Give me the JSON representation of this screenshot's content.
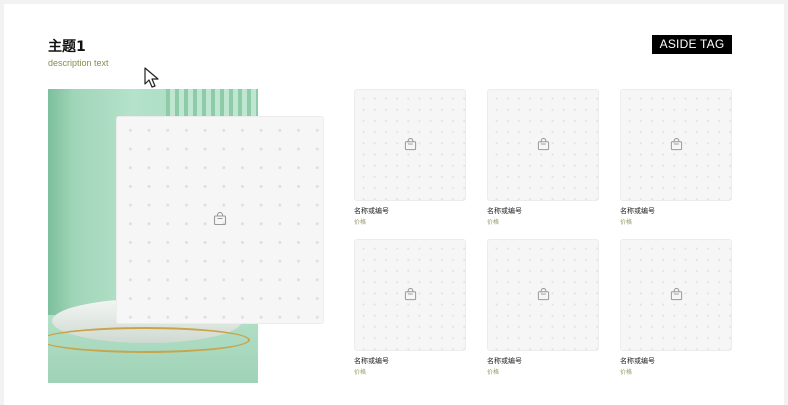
{
  "header": {
    "title": "主题1",
    "description": "description text",
    "aside_tag": "ASIDE TAG"
  },
  "products": [
    {
      "name": "名称或编号",
      "price": "价格"
    },
    {
      "name": "名称或编号",
      "price": "价格"
    },
    {
      "name": "名称或编号",
      "price": "价格"
    },
    {
      "name": "名称或编号",
      "price": "价格"
    },
    {
      "name": "名称或编号",
      "price": "价格"
    },
    {
      "name": "名称或编号",
      "price": "价格"
    }
  ],
  "colors": {
    "aside_tag_bg": "#000000",
    "hero_green": "#a5d8bd",
    "description_text": "#8b8b50"
  },
  "icons": {
    "placeholder": "shopping-bag-icon",
    "cursor": "mouse-pointer-icon"
  }
}
